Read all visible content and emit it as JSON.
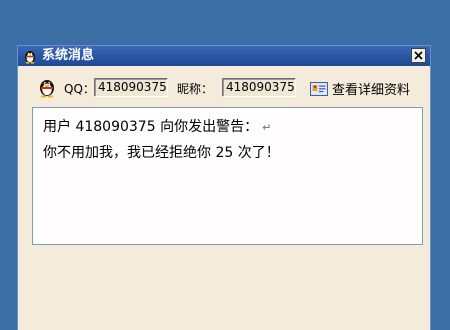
{
  "window": {
    "title": "系统消息",
    "colors": {
      "titlebar": "#2b56a4",
      "body": "#f4ebdb",
      "desktop": "#3a6ea5"
    }
  },
  "info": {
    "qq_label": "QQ：",
    "qq_value": "418090375",
    "nickname_label": "昵称：",
    "nickname_value": "418090375",
    "details_link": "查看详细资料"
  },
  "message": {
    "line1": "用户 418090375 向你发出警告：",
    "return_mark": "↵",
    "line2": "你不用加我，我已经拒绝你 25 次了！"
  },
  "icons": {
    "title": "penguin-icon",
    "close": "close-icon",
    "qq": "penguin-icon",
    "details": "id-card-icon"
  }
}
